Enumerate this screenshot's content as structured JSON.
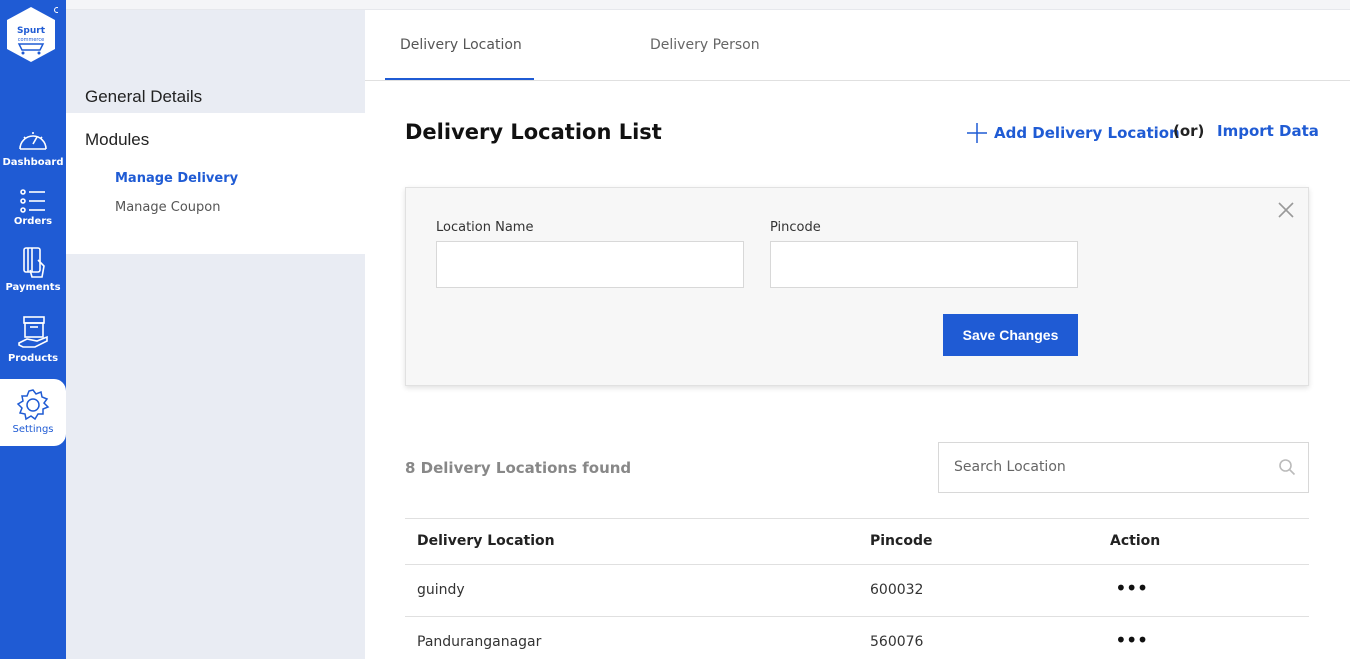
{
  "brand": {
    "logo_text": "Spurt",
    "logo_subtext": "commerce",
    "accent": "#1f5bd4"
  },
  "rail": {
    "items": [
      {
        "label": "Dashboard",
        "icon": "speedometer-icon"
      },
      {
        "label": "Orders",
        "icon": "list-icon"
      },
      {
        "label": "Payments",
        "icon": "payment-card-icon"
      },
      {
        "label": "Products",
        "icon": "box-hand-icon"
      },
      {
        "label": "Settings",
        "icon": "gear-icon",
        "active": true
      }
    ]
  },
  "side_panel": {
    "general_details": "General Details",
    "modules": "Modules",
    "sub_items": [
      {
        "label": "Manage Delivery",
        "active": true
      },
      {
        "label": "Manage Coupon"
      }
    ]
  },
  "tabs": [
    {
      "label": "Delivery Location",
      "active": true
    },
    {
      "label": "Delivery Person"
    }
  ],
  "header": {
    "title": "Delivery Location List",
    "add_label": "Add Delivery Location",
    "or_label": "(or)",
    "import_label": "Import Data"
  },
  "form": {
    "location_label": "Location Name",
    "location_value": "",
    "pincode_label": "Pincode",
    "pincode_value": "",
    "save_label": "Save Changes"
  },
  "list": {
    "found_text": "8 Delivery Locations found",
    "search_placeholder": "Search Location",
    "columns": [
      "Delivery Location",
      "Pincode",
      "Action"
    ],
    "rows": [
      {
        "location": "guindy",
        "pincode": "600032",
        "action": "•••"
      },
      {
        "location": "Panduranganagar",
        "pincode": "560076",
        "action": "•••"
      }
    ]
  }
}
